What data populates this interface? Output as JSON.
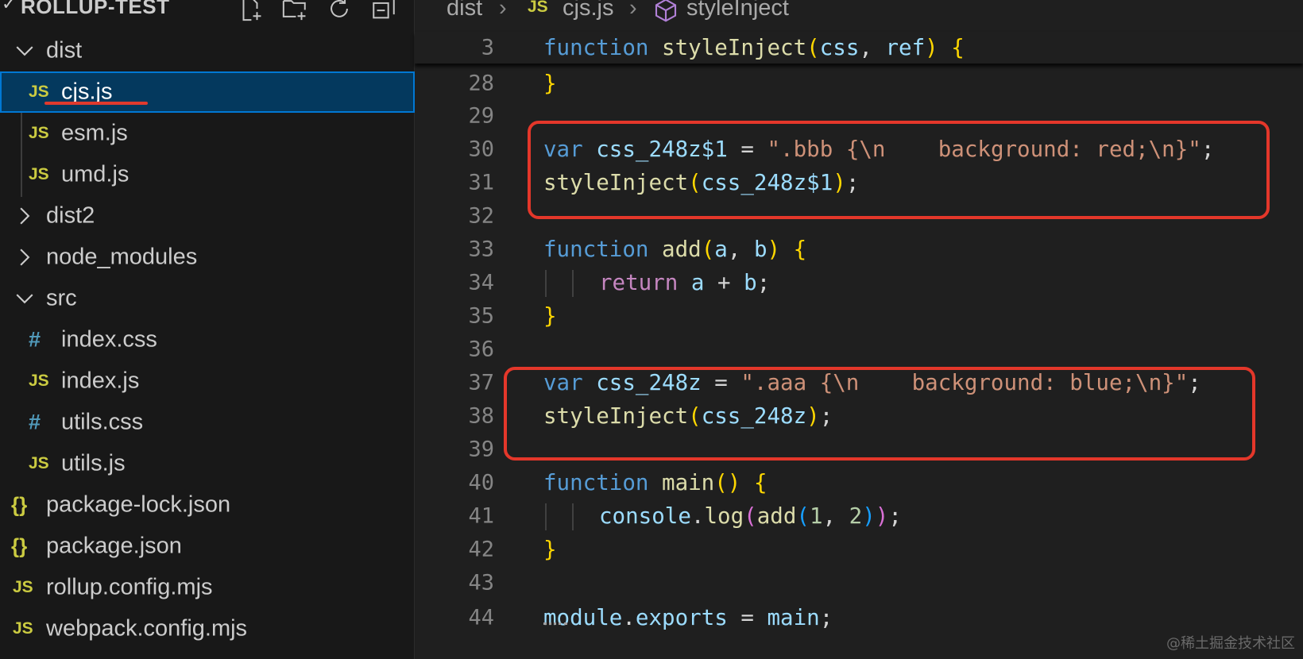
{
  "explorer": {
    "title": "ROLLUP-TEST",
    "actions": [
      "new-file-icon",
      "new-folder-icon",
      "refresh-icon",
      "collapse-all-icon"
    ],
    "items": [
      {
        "label": "dist",
        "type": "folder",
        "expanded": true
      },
      {
        "label": "cjs.js",
        "type": "js",
        "selected": true
      },
      {
        "label": "esm.js",
        "type": "js"
      },
      {
        "label": "umd.js",
        "type": "js"
      },
      {
        "label": "dist2",
        "type": "folder",
        "expanded": false
      },
      {
        "label": "node_modules",
        "type": "folder",
        "expanded": false
      },
      {
        "label": "src",
        "type": "folder",
        "expanded": true
      },
      {
        "label": "index.css",
        "type": "css"
      },
      {
        "label": "index.js",
        "type": "js"
      },
      {
        "label": "utils.css",
        "type": "css"
      },
      {
        "label": "utils.js",
        "type": "js"
      },
      {
        "label": "package-lock.json",
        "type": "json"
      },
      {
        "label": "package.json",
        "type": "json"
      },
      {
        "label": "rollup.config.mjs",
        "type": "js"
      },
      {
        "label": "webpack.config.mjs",
        "type": "js"
      }
    ],
    "icon_glyphs": {
      "js": "JS",
      "css": "#",
      "json": "{}"
    }
  },
  "breadcrumb": {
    "folder": "dist",
    "file_icon": "JS",
    "file": "cjs.js",
    "symbol": "styleInject"
  },
  "editor": {
    "sticky_line": {
      "number": "3"
    },
    "line_numbers": [
      "28",
      "29",
      "30",
      "31",
      "32",
      "33",
      "34",
      "35",
      "36",
      "37",
      "38",
      "39",
      "40",
      "41",
      "42",
      "43",
      "44"
    ],
    "code": {
      "l3_kw": "function",
      "l3_fn": "styleInject",
      "l3_p1": "css",
      "l3_p2": "ref",
      "l30_kw": "var",
      "l30_var": "css_248z$1",
      "l30_str": "\".bbb {\\n    background: red;\\n}\"",
      "l31_fn": "styleInject",
      "l31_arg": "css_248z$1",
      "l33_kw": "function",
      "l33_fn": "add",
      "l33_a": "a",
      "l33_b": "b",
      "l34_kw": "return",
      "l34_a": "a",
      "l34_b": "b",
      "l37_kw": "var",
      "l37_var": "css_248z",
      "l37_str": "\".aaa {\\n    background: blue;\\n}\"",
      "l38_fn": "styleInject",
      "l38_arg": "css_248z",
      "l40_kw": "function",
      "l40_fn": "main",
      "l41_obj": "console",
      "l41_method": "log",
      "l41_fn": "add",
      "l41_n1": "1",
      "l41_n2": "2",
      "l44_obj": "module",
      "l44_prop": "exports",
      "l44_val": "main"
    }
  },
  "watermark": "@稀土掘金技术社区",
  "colors": {
    "annotation_red": "#e4372a",
    "selection_bg": "#04395e",
    "selection_border": "#0078d4"
  }
}
